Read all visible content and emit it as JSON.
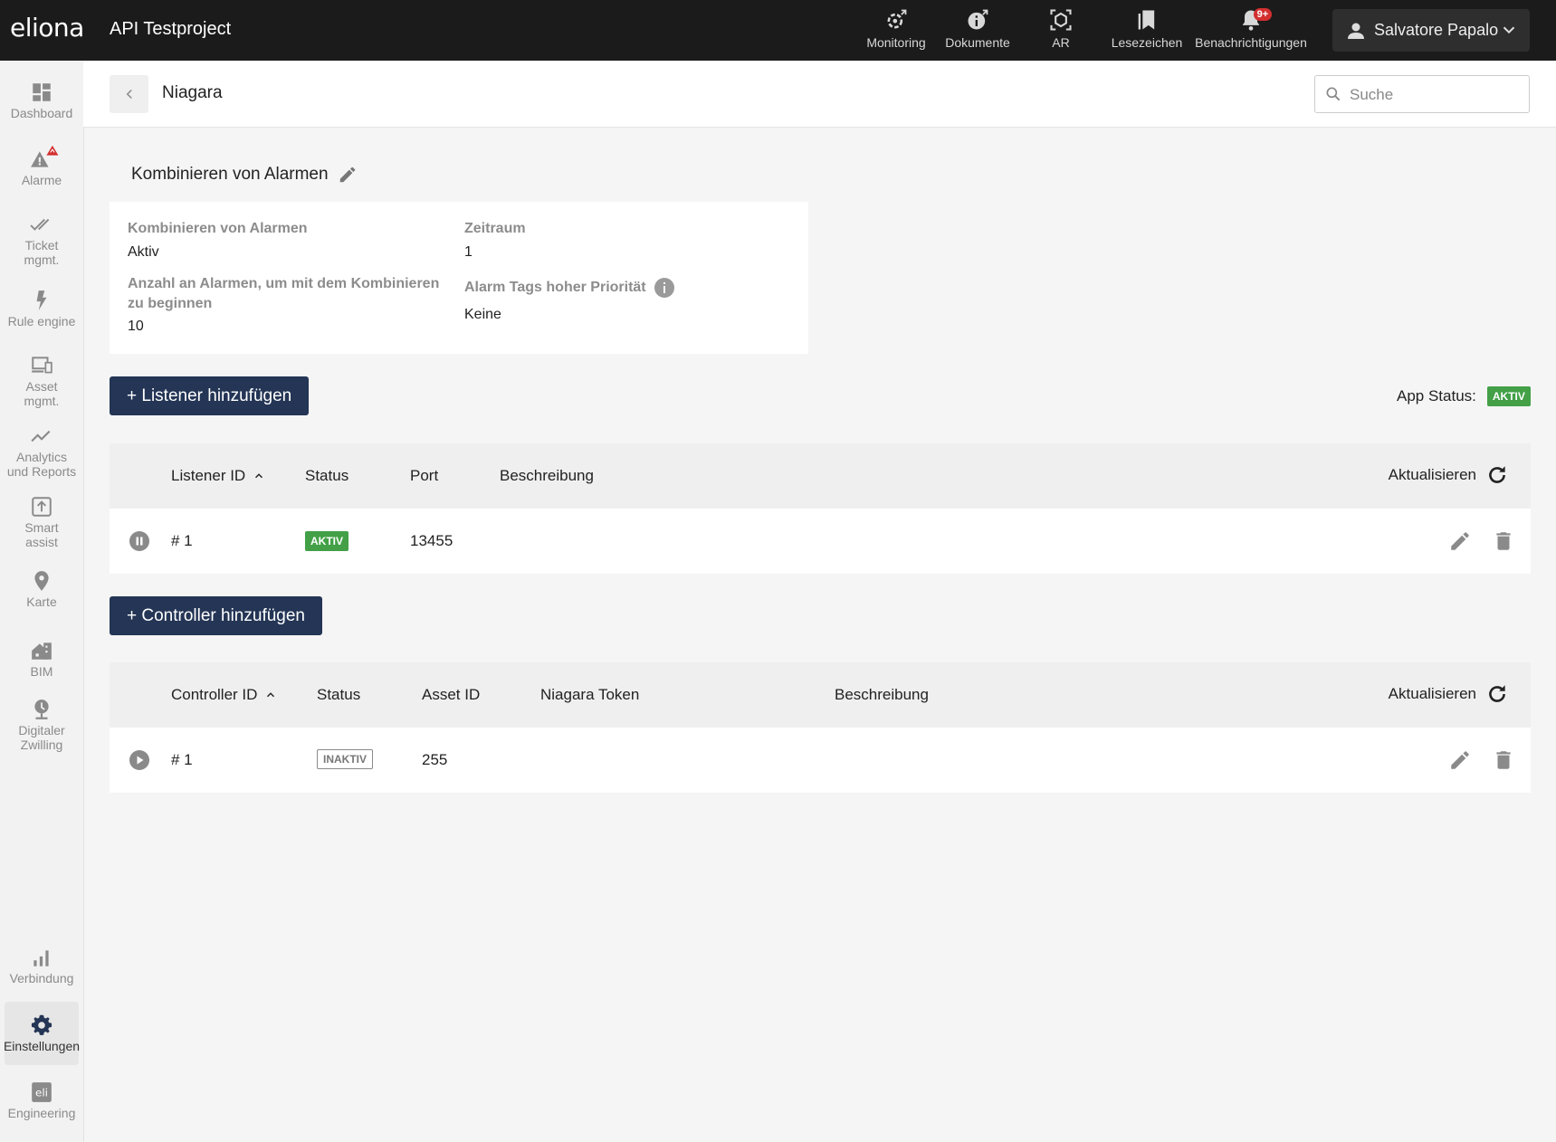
{
  "app": {
    "logo": "eliona",
    "project": "API Testproject"
  },
  "topnav": [
    {
      "label": "Monitoring",
      "icon": "monitoring-icon"
    },
    {
      "label": "Dokumente",
      "icon": "info-icon"
    },
    {
      "label": "AR",
      "icon": "ar-cube-icon"
    },
    {
      "label": "Lesezeichen",
      "icon": "bookmark-icon"
    },
    {
      "label": "Benachrichtigungen",
      "icon": "bell-icon",
      "badge": "9+"
    }
  ],
  "user": {
    "name": "Salvatore Papalo"
  },
  "sidebar": {
    "items": [
      {
        "label": "Dashboard"
      },
      {
        "label": "Alarme"
      },
      {
        "label": "Ticket\nmgmt."
      },
      {
        "label": "Rule engine"
      },
      {
        "label": "Asset\nmgmt."
      },
      {
        "label": "Analytics\nund Reports"
      },
      {
        "label": "Smart\nassist"
      },
      {
        "label": "Karte"
      },
      {
        "label": "BIM"
      },
      {
        "label": "Digitaler\nZwilling"
      },
      {
        "label": "Verbindung"
      },
      {
        "label": "Einstellungen"
      },
      {
        "label": "Engineering"
      }
    ]
  },
  "header": {
    "title": "Niagara",
    "search_placeholder": "Suche"
  },
  "section": {
    "title": "Kombinieren von Alarmen"
  },
  "info": {
    "combine_label": "Kombinieren von Alarmen",
    "combine_value": "Aktiv",
    "timespan_label": "Zeitraum",
    "timespan_value": "1",
    "count_label": "Anzahl an Alarmen, um mit dem Kombinieren zu beginnen",
    "count_value": "10",
    "tags_label": "Alarm Tags hoher Priorität",
    "tags_value": "Keine"
  },
  "listener": {
    "add_label": "+ Listener hinzufügen",
    "columns": [
      "Listener ID",
      "Status",
      "Port",
      "Beschreibung"
    ],
    "refresh_label": "Aktualisieren",
    "rows": [
      {
        "id": "# 1",
        "status": "AKTIV",
        "port": "13455",
        "description": ""
      }
    ]
  },
  "app_status": {
    "label": "App Status:",
    "value": "AKTIV"
  },
  "controller": {
    "add_label": "+ Controller hinzufügen",
    "columns": [
      "Controller ID",
      "Status",
      "Asset ID",
      "Niagara Token",
      "Beschreibung"
    ],
    "refresh_label": "Aktualisieren",
    "rows": [
      {
        "id": "# 1",
        "status": "INAKTIV",
        "asset_id": "255",
        "token": "",
        "description": ""
      }
    ]
  },
  "colors": {
    "topbar": "#1b1b1b",
    "primary": "#243555",
    "active_green": "#43a047",
    "badge_red": "#d32f2f"
  }
}
